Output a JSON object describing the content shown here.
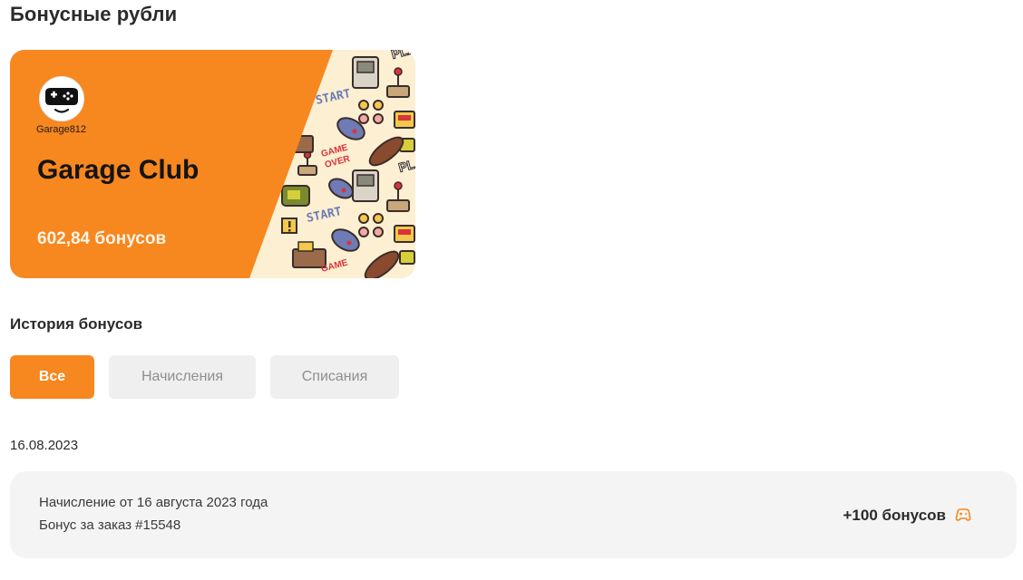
{
  "page": {
    "title": "Бонусные рубли"
  },
  "card": {
    "logo_caption": "Garage812",
    "name": "Garage Club",
    "balance": "602,84 бонусов",
    "pattern_texts": [
      "START",
      "GAME",
      "OVER",
      "PLAY"
    ],
    "colors": {
      "orange": "#f7871f",
      "pattern_bg": "#fcefd2"
    },
    "logo_icon": "gamepad-face-icon"
  },
  "history": {
    "title": "История бонусов",
    "tabs": [
      {
        "label": "Все",
        "active": true
      },
      {
        "label": "Начисления",
        "active": false
      },
      {
        "label": "Списания",
        "active": false
      }
    ],
    "groups": [
      {
        "date": "16.08.2023",
        "items": [
          {
            "title": "Начисление от 16 августа 2023 года",
            "subtitle": "Бонус за заказ #15548",
            "amount": "+100 бонусов",
            "icon": "gamepad-icon"
          }
        ]
      }
    ]
  }
}
